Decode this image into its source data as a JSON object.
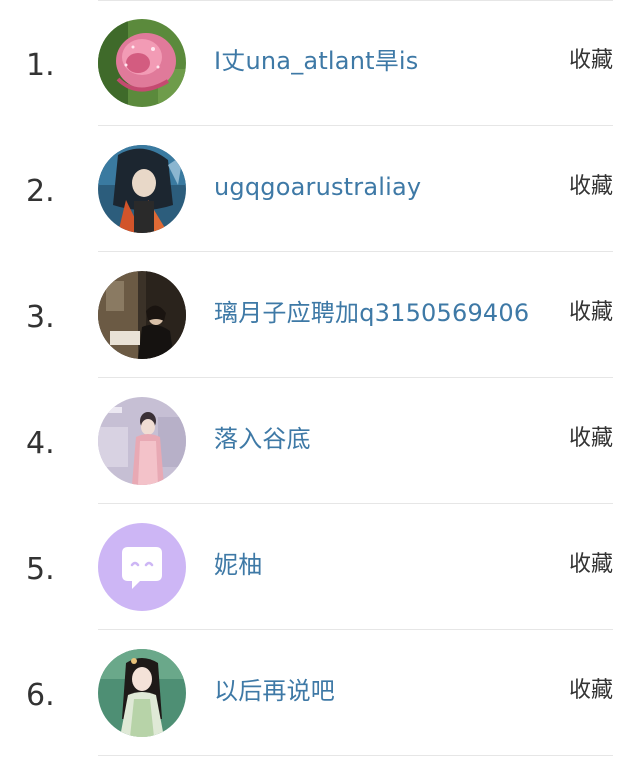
{
  "list": {
    "fav_label": "收藏",
    "items": [
      {
        "rank": "1.",
        "name": "I丈una_atlant旱is",
        "fav": "收藏",
        "avatar": "pink-rose-photo"
      },
      {
        "rank": "2.",
        "name": "ugqgoarustraliay",
        "fav": "收藏",
        "avatar": "anime-character-photo"
      },
      {
        "rank": "3.",
        "name": "璃月子应聘加q3150569406",
        "fav": "收藏",
        "avatar": "dim-room-photo"
      },
      {
        "rank": "4.",
        "name": "落入谷底",
        "fav": "收藏",
        "avatar": "lavender-girl-photo"
      },
      {
        "rank": "5.",
        "name": "妮柚",
        "fav": "收藏",
        "avatar": "default-chat-avatar"
      },
      {
        "rank": "6.",
        "name": "以后再说吧",
        "fav": "收藏",
        "avatar": "ancient-style-girl-photo"
      }
    ]
  },
  "colors": {
    "name_link": "#3e79a6",
    "text": "#333333",
    "divider": "#e6e6e6",
    "default_avatar_bg": "#cdb6f5"
  }
}
